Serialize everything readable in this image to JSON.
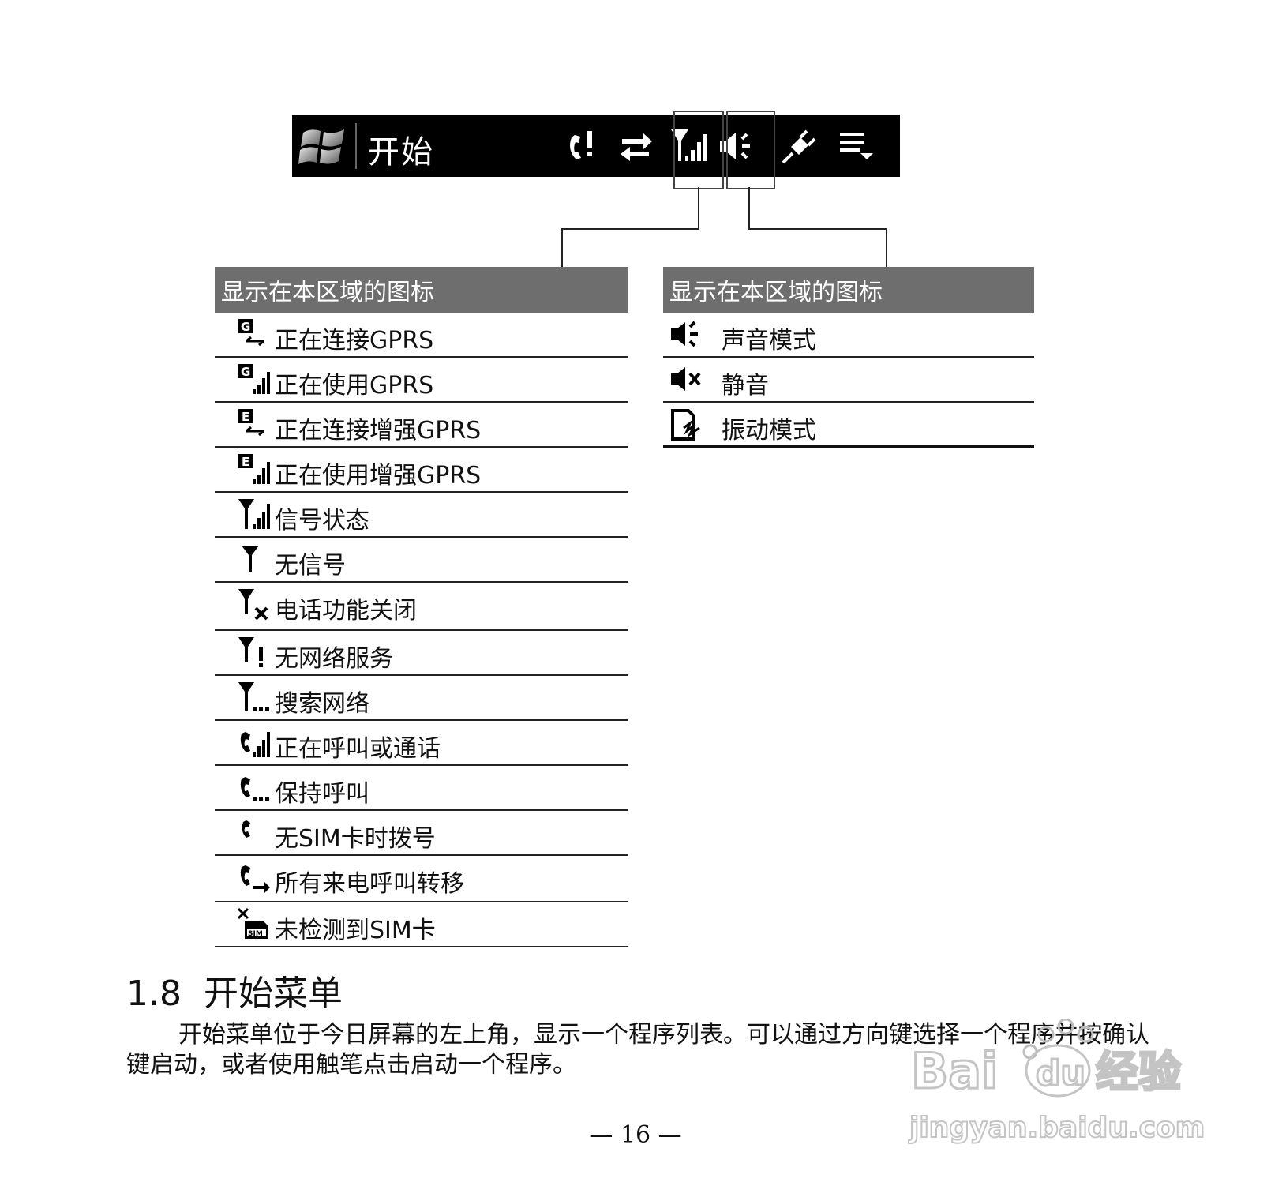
{
  "taskbar": {
    "start_label": "开始",
    "icons": [
      "missed-call-icon",
      "sync-icon",
      "signal-icon",
      "volume-icon",
      "power-plug-icon",
      "menu-dropdown-icon"
    ]
  },
  "left_table": {
    "header": "显示在本区域的图标",
    "rows": [
      {
        "icon": "gprs-connecting-icon",
        "label": "正在连接GPRS"
      },
      {
        "icon": "gprs-in-use-icon",
        "label": "正在使用GPRS"
      },
      {
        "icon": "egprs-connecting-icon",
        "label": "正在连接增强GPRS"
      },
      {
        "icon": "egprs-in-use-icon",
        "label": "正在使用增强GPRS"
      },
      {
        "icon": "signal-strength-icon",
        "label": "信号状态"
      },
      {
        "icon": "no-signal-icon",
        "label": "无信号"
      },
      {
        "icon": "radio-off-icon",
        "label": "电话功能关闭"
      },
      {
        "icon": "no-service-icon",
        "label": "无网络服务"
      },
      {
        "icon": "searching-network-icon",
        "label": "搜索网络"
      },
      {
        "icon": "call-in-progress-icon",
        "label": "正在呼叫或通话"
      },
      {
        "icon": "call-on-hold-icon",
        "label": "保持呼叫"
      },
      {
        "icon": "no-sim-call-icon",
        "label": "无SIM卡时拨号"
      },
      {
        "icon": "call-forwarding-icon",
        "label": "所有来电呼叫转移"
      },
      {
        "icon": "no-sim-card-icon",
        "label": "未检测到SIM卡"
      }
    ]
  },
  "right_table": {
    "header": "显示在本区域的图标",
    "rows": [
      {
        "icon": "sound-on-icon",
        "label": "声音模式"
      },
      {
        "icon": "mute-icon",
        "label": "静音"
      },
      {
        "icon": "vibrate-icon",
        "label": "振动模式"
      }
    ]
  },
  "section": {
    "title": "1.8  开始菜单",
    "paragraph": "开始菜单位于今日屏幕的左上角，显示一个程序列表。可以通过方向键选择一个程序并按确认键启动，或者使用触笔点击启动一个程序。"
  },
  "page_number": "— 16 —",
  "watermark": {
    "brand": "Bai du 经验",
    "url": "jingyan.baidu.com"
  }
}
